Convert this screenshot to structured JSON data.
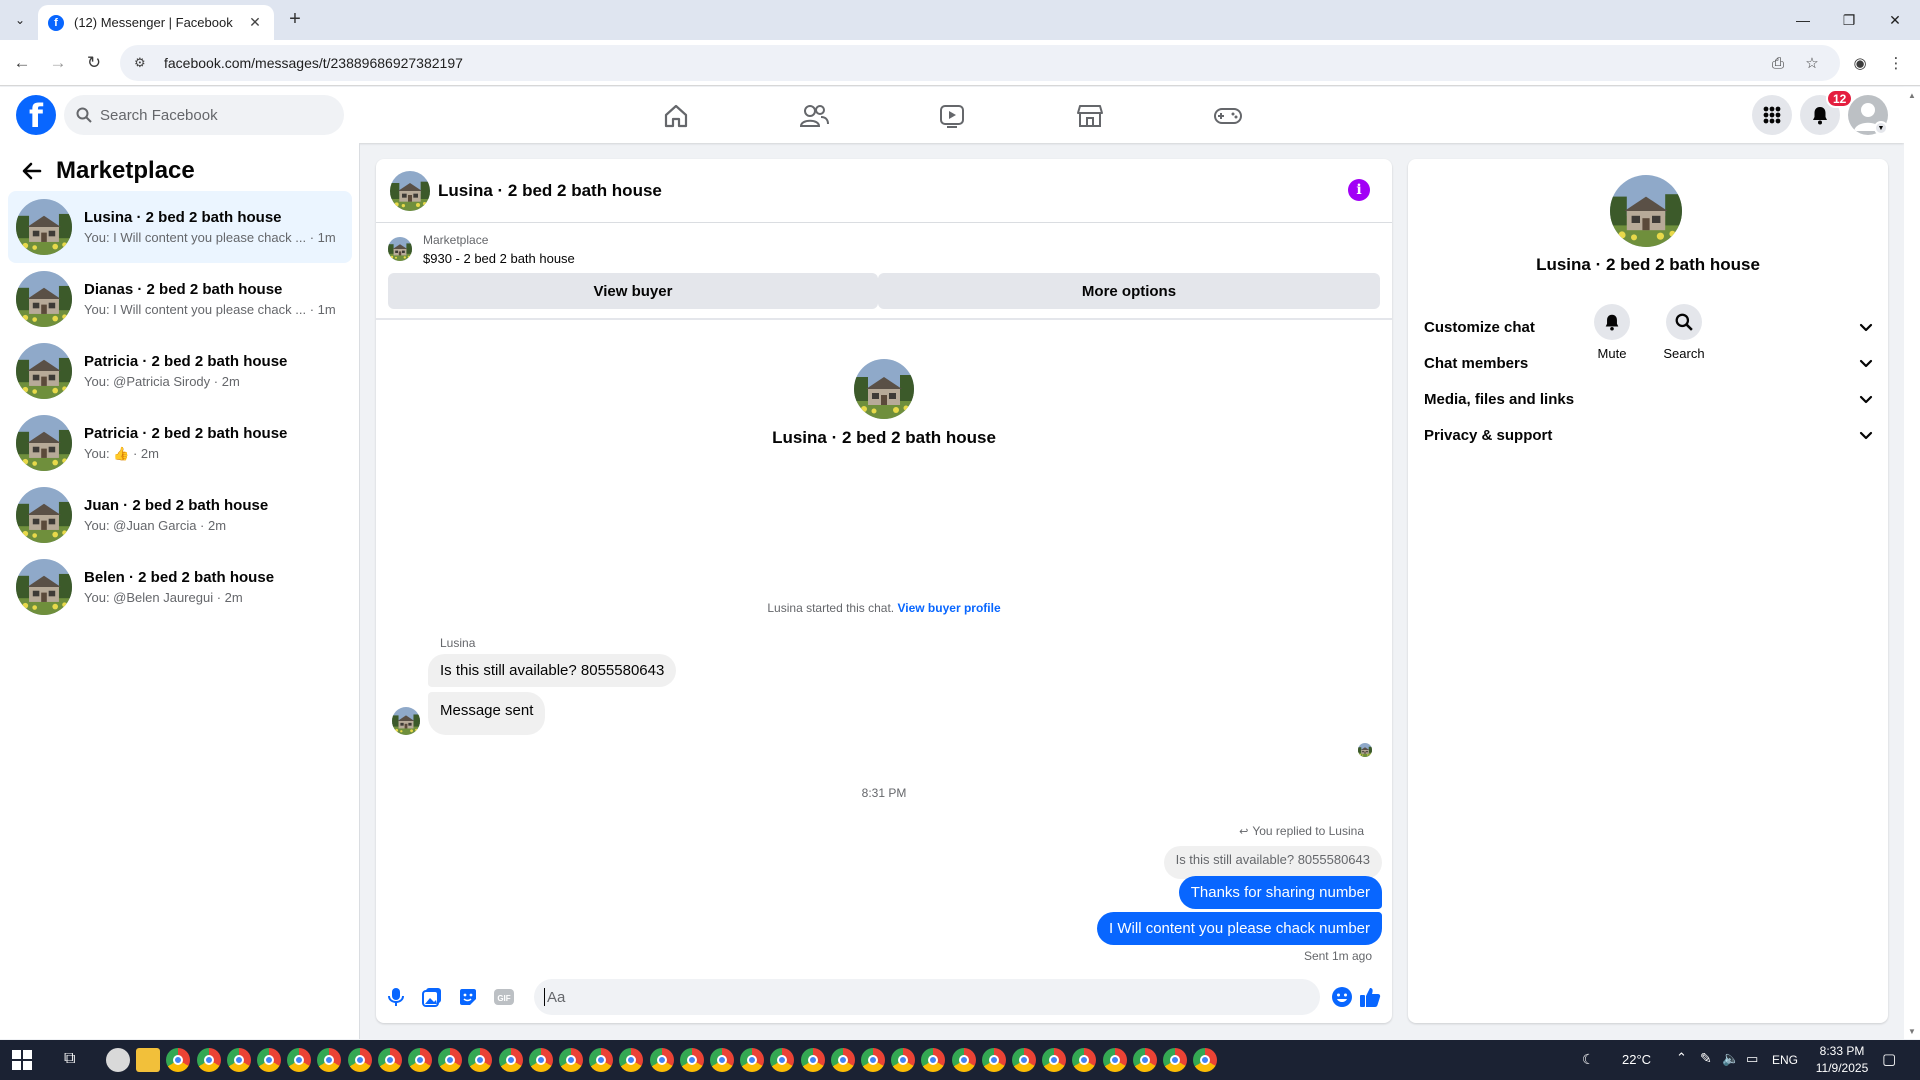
{
  "browser": {
    "tab_title": "(12) Messenger | Facebook",
    "tab_favicon": "f",
    "url": "facebook.com/messages/t/23889686927382197"
  },
  "header": {
    "search_placeholder": "Search Facebook",
    "notification_count": "12"
  },
  "sidebar": {
    "title": "Marketplace",
    "conversations": [
      {
        "title": "Lusina · 2 bed 2 bath house",
        "subtitle": "You: I Will content you please chack ... · 1m",
        "active": true
      },
      {
        "title": "Dianas · 2 bed 2 bath house",
        "subtitle": "You: I Will content you please chack ... · 1m",
        "active": false
      },
      {
        "title": "Patricia · 2 bed 2 bath house",
        "subtitle": "You: @Patricia Sirody · 2m",
        "active": false
      },
      {
        "title": "Patricia · 2 bed 2 bath house",
        "subtitle": "You: 👍 · 2m",
        "active": false
      },
      {
        "title": "Juan · 2 bed 2 bath house",
        "subtitle": "You: @Juan Garcia · 2m",
        "active": false
      },
      {
        "title": "Belen · 2 bed 2 bath house",
        "subtitle": "You: @Belen Jauregui · 2m",
        "active": false
      }
    ]
  },
  "chat": {
    "title": "Lusina · 2 bed 2 bath house",
    "listing": {
      "source": "Marketplace",
      "price_title": "$930 - 2 bed 2 bath house",
      "view_buyer": "View buyer",
      "more_options": "More options"
    },
    "intro_name": "Lusina · 2 bed 2 bath house",
    "started_text": "Lusina started this chat.",
    "started_link": "View buyer profile",
    "sender_name": "Lusina",
    "incoming": [
      "Is this still available? 8055580643",
      "Message sent"
    ],
    "timestamp": "8:31 PM",
    "replied_label": "You replied to Lusina",
    "quoted_text": "Is this still available? 8055580643",
    "outgoing": [
      "Thanks for sharing number",
      "I Will content you please chack number"
    ],
    "sent_status": "Sent 1m ago",
    "composer_placeholder": "Aa"
  },
  "info_panel": {
    "name": "Lusina · 2 bed 2 bath house",
    "mute_label": "Mute",
    "search_label": "Search",
    "sections": [
      "Customize chat",
      "Chat members",
      "Media, files and links",
      "Privacy & support"
    ]
  },
  "taskbar": {
    "weather": "22°C",
    "language": "ENG",
    "time": "8:33 PM",
    "date": "11/9/2025"
  },
  "colors": {
    "brand_blue": "#0866ff",
    "info_purple": "#a200f6",
    "badge_red": "#e41e3f"
  }
}
